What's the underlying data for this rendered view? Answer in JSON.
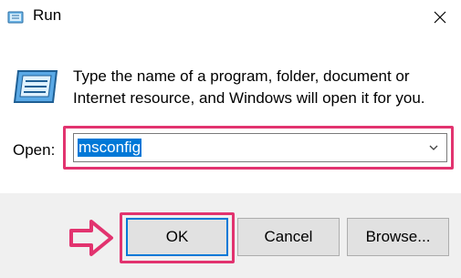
{
  "window": {
    "title": "Run"
  },
  "description": "Type the name of a program, folder, document or Internet resource, and Windows will open it for you.",
  "open_field": {
    "label": "Open:",
    "value": "msconfig"
  },
  "buttons": {
    "ok": "OK",
    "cancel": "Cancel",
    "browse": "Browse..."
  },
  "icons": [
    "run-app-icon",
    "close-icon",
    "run-dialog-icon",
    "chevron-down-icon",
    "arrow-right-icon"
  ],
  "colors": {
    "highlight": "#e2336f",
    "selection": "#0078d7",
    "footer": "#f0f0f0"
  }
}
